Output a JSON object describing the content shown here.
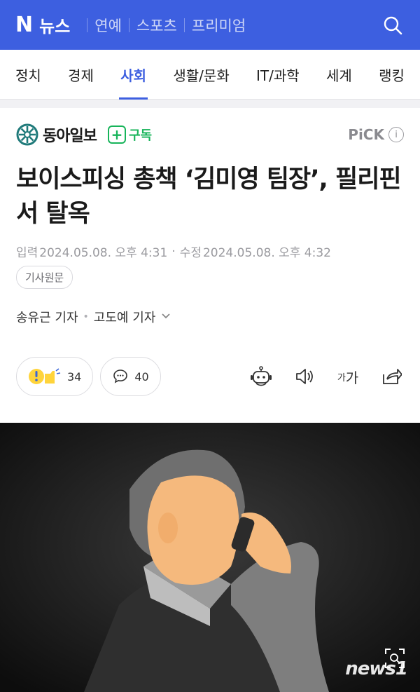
{
  "app": {
    "logo": "N",
    "service": "뉴스",
    "top_nav": [
      "연예",
      "스포츠",
      "프리미엄"
    ]
  },
  "categories": [
    {
      "label": "정치",
      "active": false
    },
    {
      "label": "경제",
      "active": false
    },
    {
      "label": "사회",
      "active": true
    },
    {
      "label": "생활/문화",
      "active": false
    },
    {
      "label": "IT/과학",
      "active": false
    },
    {
      "label": "세계",
      "active": false
    },
    {
      "label": "랭킹",
      "active": false
    }
  ],
  "press": {
    "name": "동아일보",
    "subscribe_label": "구독",
    "pick_label": "PiCK",
    "info_label": "i"
  },
  "article": {
    "title": "보이스피싱 총책 ‘김미영 팀장’, 필리핀서 탈옥",
    "input_label": "입력",
    "input_date": "2024.05.08. 오후 4:31",
    "modified_label": "수정",
    "modified_date": "2024.05.08. 오후 4:32",
    "original_label": "기사원문",
    "reporters": [
      "송유근 기자",
      "고도예 기자"
    ]
  },
  "reactions": {
    "reaction_count": "34",
    "comment_count": "40",
    "font_label_small": "가",
    "font_label_large": "가"
  },
  "photo": {
    "credit": "news1"
  },
  "colors": {
    "brand": "#3d5fe0",
    "subscribe": "#17b45a"
  }
}
